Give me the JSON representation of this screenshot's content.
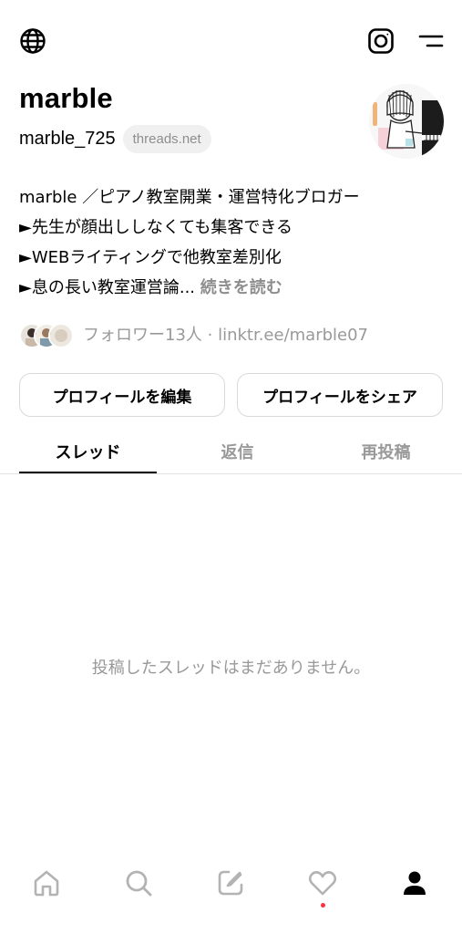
{
  "profile": {
    "display_name": "marble",
    "username": "marble_725",
    "domain_chip": "threads.net"
  },
  "bio": {
    "lines": [
      "marble ／ピアノ教室開業・運営特化ブロガー",
      "►先生が顔出ししなくても集客できる",
      "►WEBライティングで他教室差別化",
      "►息の長い教室運営論..."
    ],
    "more_label": "続きを読む"
  },
  "followers": {
    "text": "フォロワー13人 · linktr.ee/marble07"
  },
  "buttons": {
    "edit_profile": "プロフィールを編集",
    "share_profile": "プロフィールをシェア"
  },
  "tabs": [
    {
      "label": "スレッド",
      "active": true
    },
    {
      "label": "返信",
      "active": false
    },
    {
      "label": "再投稿",
      "active": false
    }
  ],
  "empty_state": {
    "message": "投稿したスレッドはまだありません。"
  },
  "icons": {
    "top_left": "globe-icon",
    "top_right_1": "instagram-icon",
    "top_right_2": "menu-icon",
    "nav": [
      "home-icon",
      "search-icon",
      "compose-icon",
      "heart-icon",
      "profile-icon"
    ]
  },
  "colors": {
    "text": "#000000",
    "muted": "#999999",
    "border": "#d9d9d9",
    "chip_bg": "#f0f0f0",
    "notification_dot": "#ff3040"
  }
}
